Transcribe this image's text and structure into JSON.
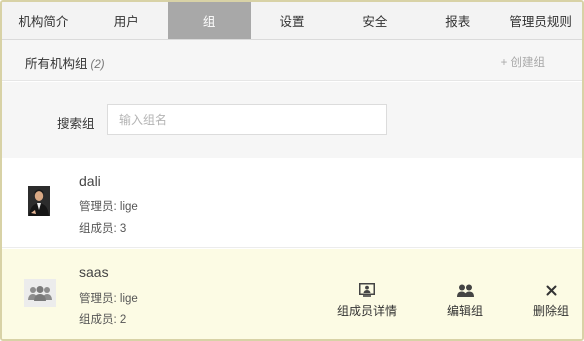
{
  "tabs": [
    {
      "label": "机构简介",
      "active": false
    },
    {
      "label": "用户",
      "active": false
    },
    {
      "label": "组",
      "active": true
    },
    {
      "label": "设置",
      "active": false
    },
    {
      "label": "安全",
      "active": false
    },
    {
      "label": "报表",
      "active": false
    },
    {
      "label": "管理员规则",
      "active": false
    }
  ],
  "header": {
    "title": "所有机构组",
    "count": "(2)",
    "create_label": "+ 创建组"
  },
  "search": {
    "label": "搜索组",
    "placeholder": "输入组名",
    "value": ""
  },
  "groups": [
    {
      "name": "dali",
      "admin": "管理员: lige",
      "members": "组成员: 3",
      "avatar": "photo-avatar-icon"
    },
    {
      "name": "saas",
      "admin": "管理员: lige",
      "members": "组成员: 2",
      "avatar": "group-avatar-icon"
    }
  ],
  "actions": {
    "details": "组成员详情",
    "edit": "编辑组",
    "delete": "删除组"
  },
  "colors": {
    "active_tab": "#a8a8a8",
    "highlight_row": "#fcfbe4",
    "frame_border": "#d8d2a6"
  }
}
